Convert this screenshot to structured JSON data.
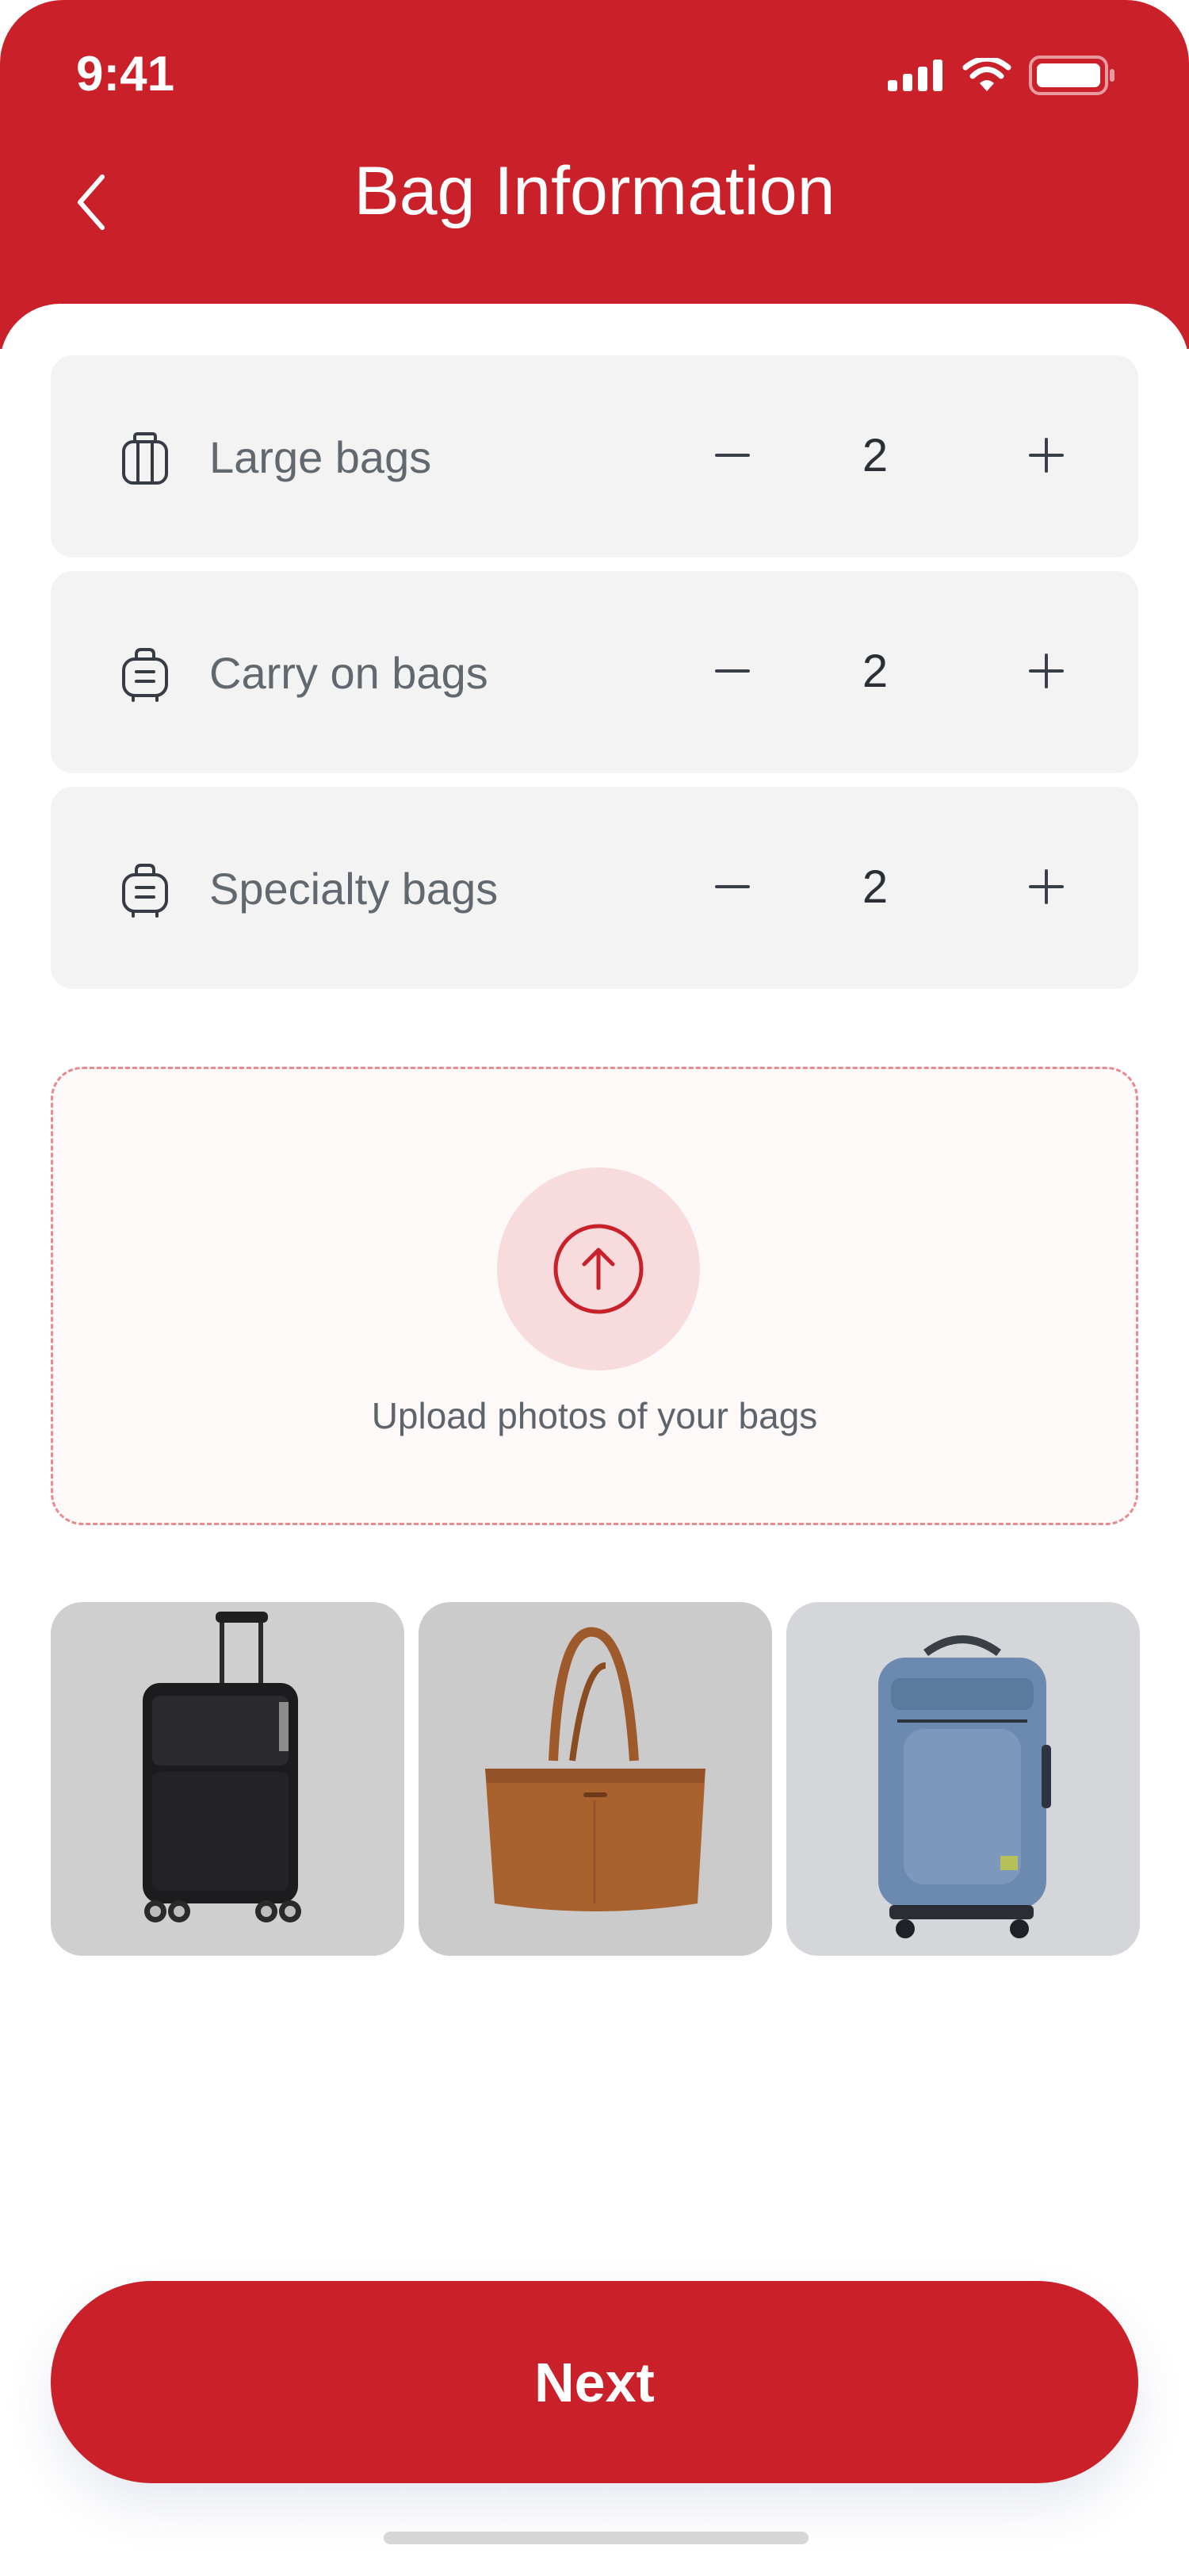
{
  "status_bar": {
    "time": "9:41"
  },
  "header": {
    "title": "Bag Information"
  },
  "bags": [
    {
      "label": "Large bags",
      "count": "2",
      "icon": "suitcase-icon"
    },
    {
      "label": "Carry on bags",
      "count": "2",
      "icon": "carry-on-bag-icon"
    },
    {
      "label": "Specialty bags",
      "count": "2",
      "icon": "specialty-bag-icon"
    }
  ],
  "stepper": {
    "minus": "−",
    "plus": "+"
  },
  "upload": {
    "text": "Upload photos of your bags",
    "icon": "upload-arrow-icon"
  },
  "photos": [
    "black-suitcase-photo",
    "brown-tote-bag-photo",
    "blue-backpack-suitcase-photo"
  ],
  "footer": {
    "next_label": "Next"
  },
  "colors": {
    "brand": "#C9202A",
    "row_bg": "#F3F3F4",
    "upload_bg": "#FCF9F8"
  }
}
